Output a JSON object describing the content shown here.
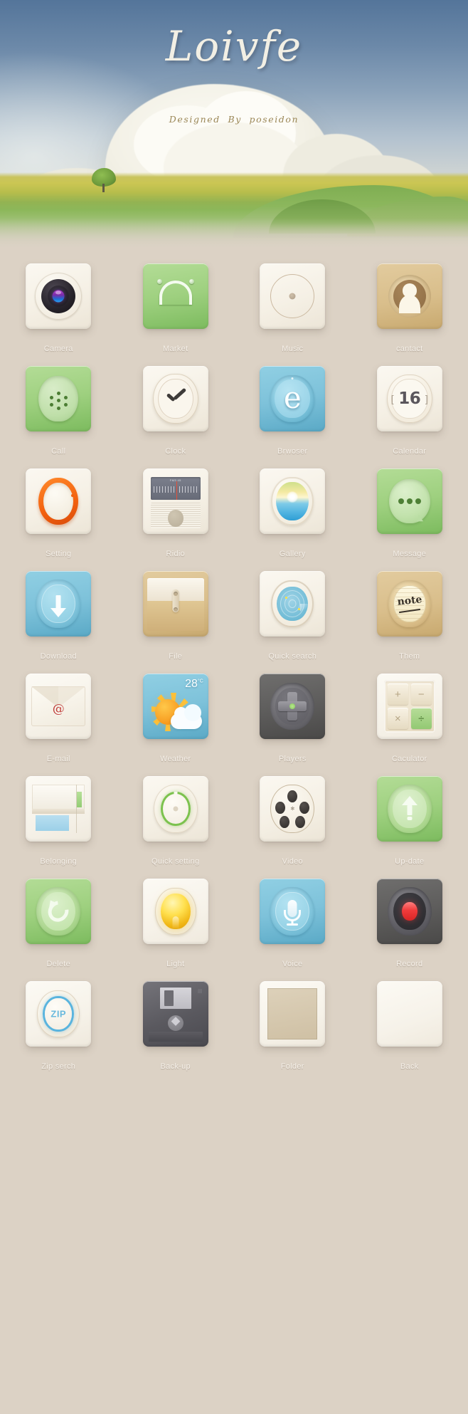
{
  "header": {
    "title": "Loivfe",
    "subtitle": "Designed  By  poseidon"
  },
  "wallpaper": {
    "description": "sky-with-clouds-over-canola-field-and-lone-tree",
    "sky_color": "#54759a",
    "field_color": "#cbc653",
    "grass_color": "#8cb75a",
    "page_background": "#dcd2c5"
  },
  "icon_grid": {
    "columns": 4,
    "rows": [
      [
        {
          "label": "Camera",
          "icon": "camera-icon",
          "tile_color": "#f5f0e5"
        },
        {
          "label": "Market",
          "icon": "shopping-bag-icon",
          "tile_color": "#9ed07f"
        },
        {
          "label": "Music",
          "icon": "vinyl-record-icon",
          "tile_color": "#f5f0e5"
        },
        {
          "label": "cantact",
          "icon": "person-avatar-icon",
          "tile_color": "#d9be8b"
        }
      ],
      [
        {
          "label": "Call",
          "icon": "phone-speaker-icon",
          "tile_color": "#9ed07f"
        },
        {
          "label": "Clock",
          "icon": "clock-icon",
          "tile_color": "#f5f0e5"
        },
        {
          "label": "Brwoser",
          "icon": "browser-e-icon",
          "tile_color": "#7ec2da",
          "glyph": "e"
        },
        {
          "label": "Calendar",
          "icon": "calendar-icon",
          "tile_color": "#f5f0e5",
          "day": "16"
        }
      ],
      [
        {
          "label": "Setting",
          "icon": "dial-knob-icon",
          "tile_color": "#f5f0e5",
          "accent": "#f2600f"
        },
        {
          "label": "Ridio",
          "icon": "radio-icon",
          "tile_color": "#f5f0e5",
          "band": "FM3 45"
        },
        {
          "label": "Gallery",
          "icon": "sunrise-photo-icon",
          "tile_color": "#f5f0e5"
        },
        {
          "label": "Message",
          "icon": "speech-bubble-icon",
          "tile_color": "#9ed07f"
        }
      ],
      [
        {
          "label": "Download",
          "icon": "download-arrow-icon",
          "tile_color": "#7ec2da"
        },
        {
          "label": "File",
          "icon": "file-envelope-icon",
          "tile_color": "#d9be8b"
        },
        {
          "label": "Quick search",
          "icon": "radar-icon",
          "tile_color": "#f5f0e5"
        },
        {
          "label": "Them",
          "icon": "note-icon",
          "tile_color": "#d9be8b",
          "glyph": "note"
        }
      ],
      [
        {
          "label": "E-mail",
          "icon": "envelope-at-icon",
          "tile_color": "#f5f0e5",
          "glyph": "@"
        },
        {
          "label": "Weather",
          "icon": "sun-cloud-icon",
          "tile_color": "#7ec2da",
          "temperature": "28",
          "unit": "°C"
        },
        {
          "label": "Players",
          "icon": "gamepad-dpad-icon",
          "tile_color": "#5e5d5c"
        },
        {
          "label": "Caculator",
          "icon": "calculator-icon",
          "tile_color": "#f5f0e5",
          "keys": [
            "+",
            "−",
            "×",
            "÷"
          ]
        }
      ],
      [
        {
          "label": "Belonging",
          "icon": "documents-stack-icon",
          "tile_color": "#f5f0e5"
        },
        {
          "label": "Quick setting",
          "icon": "green-ring-dial-icon",
          "tile_color": "#f5f0e5",
          "accent": "#7cc24e"
        },
        {
          "label": "Video",
          "icon": "film-reel-icon",
          "tile_color": "#f5f0e5"
        },
        {
          "label": "Up-date",
          "icon": "up-arrow-icon",
          "tile_color": "#9ed07f"
        }
      ],
      [
        {
          "label": "Delete",
          "icon": "undo-arrow-icon",
          "tile_color": "#9ed07f"
        },
        {
          "label": "Light",
          "icon": "light-bulb-icon",
          "tile_color": "#f5f0e5"
        },
        {
          "label": "Voice",
          "icon": "microphone-icon",
          "tile_color": "#7ec2da"
        },
        {
          "label": "Record",
          "icon": "record-button-icon",
          "tile_color": "#5e5d5c",
          "accent": "#f03b3b"
        }
      ],
      [
        {
          "label": "Zip serch",
          "icon": "zip-circle-icon",
          "tile_color": "#f5f0e5",
          "glyph": "ZIP"
        },
        {
          "label": "Back-up",
          "icon": "floppy-disk-icon",
          "tile_color": "#5a595f"
        },
        {
          "label": "Folder",
          "icon": "folder-square-icon",
          "tile_color": "#cfc0a4"
        },
        {
          "label": "Back",
          "icon": "blank-tile-icon",
          "tile_color": "#f6f2e9"
        }
      ]
    ]
  }
}
